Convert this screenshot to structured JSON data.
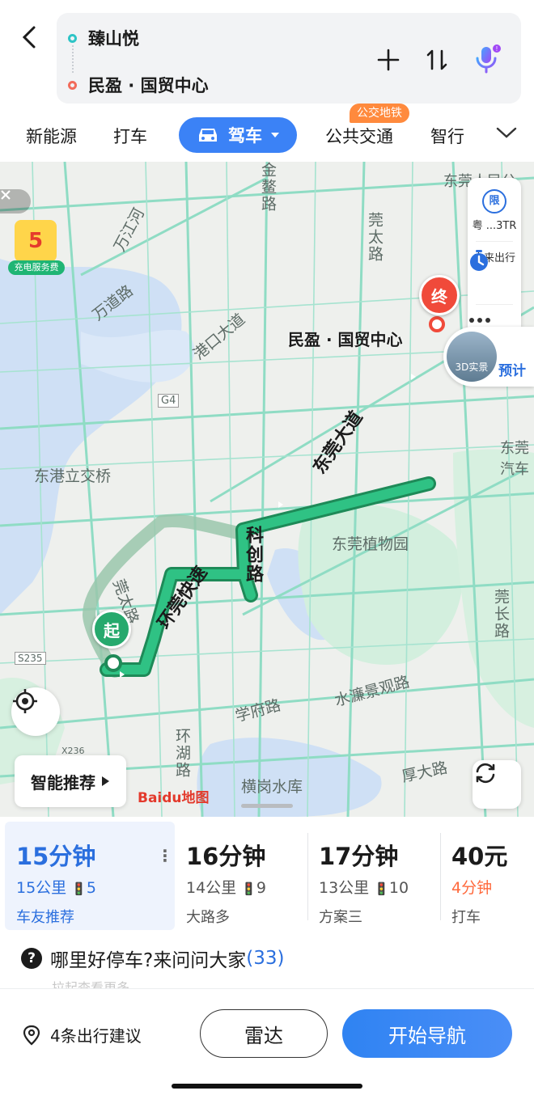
{
  "header": {
    "from": "臻山悦",
    "to": "民盈 · 国贸中心"
  },
  "tabs": {
    "items": [
      "新能源",
      "打车",
      "驾车",
      "公共交通",
      "智行"
    ],
    "active": "驾车",
    "badge": "公交地铁"
  },
  "map": {
    "labels": {
      "jinao_road": "金鳌路",
      "guantai_road": "莞太路",
      "wanjiang_road": "万江河",
      "wandao_road": "万道路",
      "gangkou": "港口大道",
      "g4": "G4",
      "donggang": "东港立交桥",
      "destination": "民盈 · 国贸中心",
      "dongguan_avenue": "东莞大道",
      "kechuang": "科创路",
      "huanguan": "环莞快速",
      "guantai_road2": "莞太路",
      "botanical": "东莞植物园",
      "guanchang": "莞长路",
      "xuefu": "学府路",
      "shuilian": "水濂景观路",
      "huanhu": "环湖路",
      "henggang": "横岗水库",
      "houda": "厚大路",
      "s235": "S235",
      "x236": "X236",
      "donguan_people": "东莞人民公",
      "dongguan_car": "东莞",
      "dongguan_car2": "汽车",
      "gongyuan": "园",
      "da": "大",
      "xi": "东",
      "su": "速",
      "baidu": "Baidu地图",
      "start_marker": "起",
      "end_marker": "终",
      "ev_badge": "充电服务费",
      "ev_number": "5",
      "preview": "3D实景",
      "preview_eta": "预计"
    },
    "side_panel": {
      "restrict_label": "粤 ...3TR",
      "restrict_icon": "限",
      "future_label": "未来出行"
    },
    "smart_label": "智能推荐"
  },
  "routes": [
    {
      "time": "15分钟",
      "distance": "15公里",
      "lights": "5",
      "tag": "车友推荐",
      "selected": true
    },
    {
      "time": "16分钟",
      "distance": "14公里",
      "lights": "9",
      "tag": "大路多"
    },
    {
      "time": "17分钟",
      "distance": "13公里",
      "lights": "10",
      "tag": "方案三"
    },
    {
      "time": "40元",
      "distance": "4分钟",
      "tag": "打车"
    }
  ],
  "question": {
    "text": "哪里好停车?来问问大家",
    "count": "(33)",
    "hint": "拉起查看更多"
  },
  "bottom": {
    "suggest": "4条出行建议",
    "radar": "雷达",
    "navigate": "开始导航"
  },
  "colors": {
    "primary": "#3b82f6",
    "route": "#1fb574",
    "route_alt": "#8fc9a6",
    "end": "#f04a3a",
    "orange": "#ff8a3d"
  }
}
